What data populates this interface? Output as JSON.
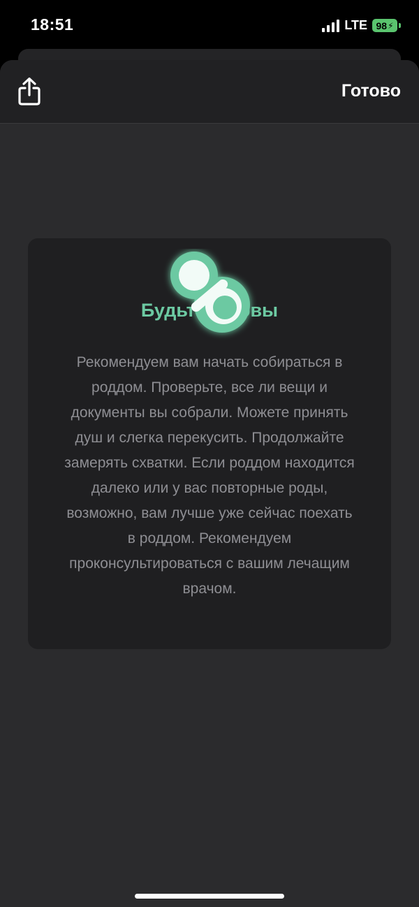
{
  "status_bar": {
    "time": "18:51",
    "network": "LTE",
    "battery": "98"
  },
  "nav": {
    "done_label": "Готово"
  },
  "card": {
    "title": "Будьте готовы",
    "text": "Рекомендуем вам начать собираться в роддом. Проверьте, все ли вещи и документы вы собрали. Можете принять душ и слегка перекусить. Продолжайте замерять схватки. Если роддом находится далеко или у вас повторные роды, возможно, вам лучше уже сейчас поехать в роддом. Рекомендуем проконсультироваться с вашим лечащим врачом."
  },
  "icons": {
    "share": "share-icon",
    "pacifier": "pacifier-icon"
  },
  "colors": {
    "accent": "#6cc9a2",
    "battery": "#5ac46e"
  }
}
